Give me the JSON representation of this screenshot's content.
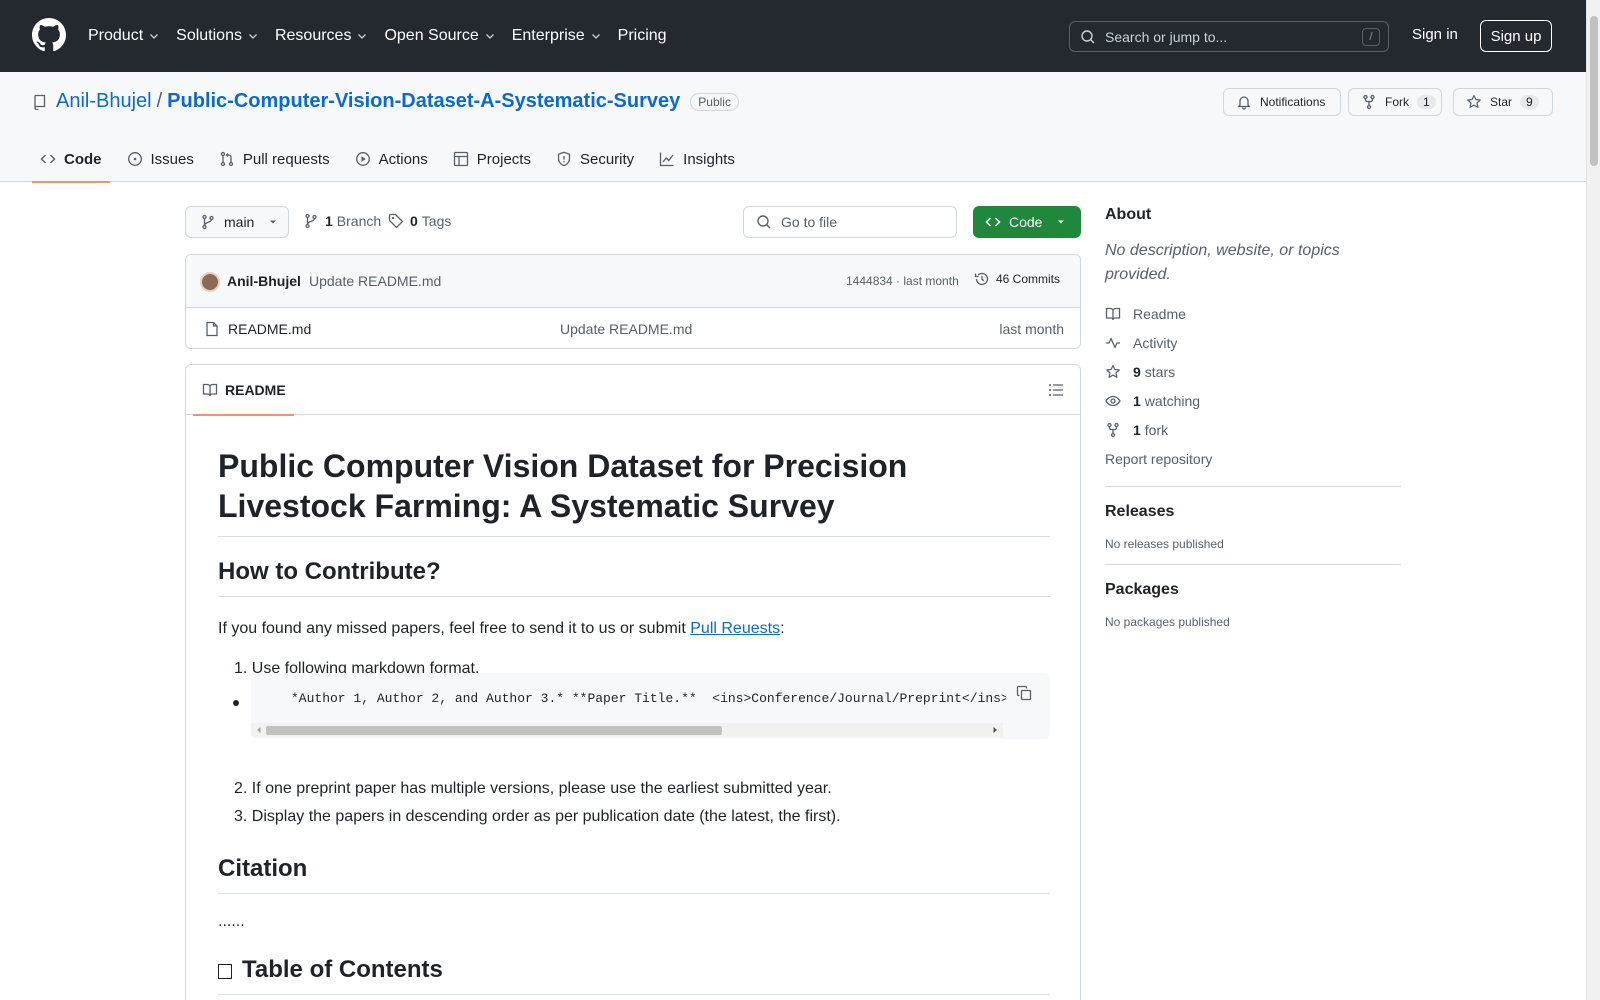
{
  "header": {
    "nav": [
      {
        "label": "Product",
        "chevron": true
      },
      {
        "label": "Solutions",
        "chevron": true
      },
      {
        "label": "Resources",
        "chevron": true
      },
      {
        "label": "Open Source",
        "chevron": true
      },
      {
        "label": "Enterprise",
        "chevron": true
      },
      {
        "label": "Pricing",
        "chevron": false
      }
    ],
    "search_placeholder": "Search or jump to...",
    "search_shortcut": "/",
    "signin": "Sign in",
    "signup": "Sign up"
  },
  "repo": {
    "owner": "Anil-Bhujel",
    "separator": "/",
    "name": "Public-Computer-Vision-Dataset-A-Systematic-Survey",
    "visibility": "Public",
    "notifications_label": "Notifications",
    "fork_label": "Fork",
    "fork_count": "1",
    "star_label": "Star",
    "star_count": "9",
    "tabs": [
      "Code",
      "Issues",
      "Pull requests",
      "Actions",
      "Projects",
      "Security",
      "Insights"
    ]
  },
  "toolbar": {
    "branch": "main",
    "branch_count": "1",
    "branch_label": "Branch",
    "tag_count": "0",
    "tag_label": "Tags",
    "goto_placeholder": "Go to file",
    "code_label": "Code"
  },
  "commit": {
    "author": "Anil-Bhujel",
    "message": "Update README.md",
    "meta": "1444834 · last month",
    "commits_label": "46 Commits"
  },
  "files": [
    {
      "name": "README.md",
      "message": "Update README.md",
      "time": "last month"
    }
  ],
  "readme": {
    "tab_label": "README",
    "title": "Public Computer Vision Dataset for Precision Livestock Farming: A Systematic Survey",
    "h2_contribute": "How to Contribute?",
    "intro_text": "If you found any missed papers, feel free to send it to us or submit ",
    "intro_link": "Pull Reuests",
    "intro_end": ":",
    "list": [
      "Use following markdown format.",
      "If one preprint paper has multiple versions, please use the earliest submitted year.",
      "Display the papers in descending order as per publication date (the latest, the first)."
    ],
    "list_numbers": [
      "1.",
      "2.",
      "3."
    ],
    "code": "*Author 1, Author 2, and Author 3.* **Paper Title.**  <ins>Conference/Journal/Preprint</ins> Year. [[Paper](link)] [[Code](link)]",
    "h2_citation": "Citation",
    "citation_text": "......",
    "h2_toc": "Table of Contents"
  },
  "sidebar": {
    "about_title": "About",
    "about_desc": "No description, website, or topics provided.",
    "links": [
      {
        "icon": "book-icon",
        "count": "",
        "label": "Readme"
      },
      {
        "icon": "pulse-icon",
        "count": "",
        "label": "Activity"
      },
      {
        "icon": "star-icon",
        "count": "9",
        "label": "stars"
      },
      {
        "icon": "eye-icon",
        "count": "1",
        "label": "watching"
      },
      {
        "icon": "fork-icon",
        "count": "1",
        "label": "fork"
      }
    ],
    "report": "Report repository",
    "releases_title": "Releases",
    "releases_text": "No releases published",
    "packages_title": "Packages",
    "packages_text": "No packages published"
  }
}
